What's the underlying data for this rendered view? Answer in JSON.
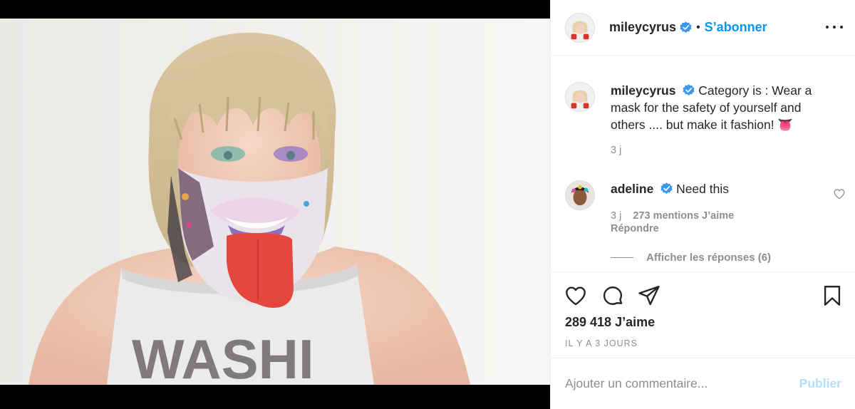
{
  "post": {
    "username": "mileycyrus",
    "separator": "•",
    "follow_label": "S’abonner"
  },
  "caption": {
    "username": "mileycyrus",
    "text": "Category is : Wear a mask for the safety of yourself and others .... but make it fashion! 👅",
    "time": "3 j"
  },
  "comment": {
    "username": "adeline",
    "text": "Need this",
    "time": "3 j",
    "likes": "273 mentions J’aime",
    "reply_label": "Répondre",
    "view_replies": "Afficher les réponses (6)"
  },
  "actions": {
    "likes_count": "289 418 J’aime",
    "timestamp": "IL Y A 3 JOURS"
  },
  "add_comment": {
    "placeholder": "Ajouter un commentaire...",
    "publish_label": "Publier"
  },
  "icons": {
    "like": "heart-icon",
    "comment": "comment-icon",
    "share": "paper-plane-icon",
    "save": "bookmark-icon",
    "more": "more-options-icon",
    "verified": "verified-badge-icon"
  },
  "colors": {
    "accent": "#0095f6",
    "verified": "#3897f0",
    "muted": "#8e8e8e",
    "publish_disabled": "#b2dffc"
  }
}
